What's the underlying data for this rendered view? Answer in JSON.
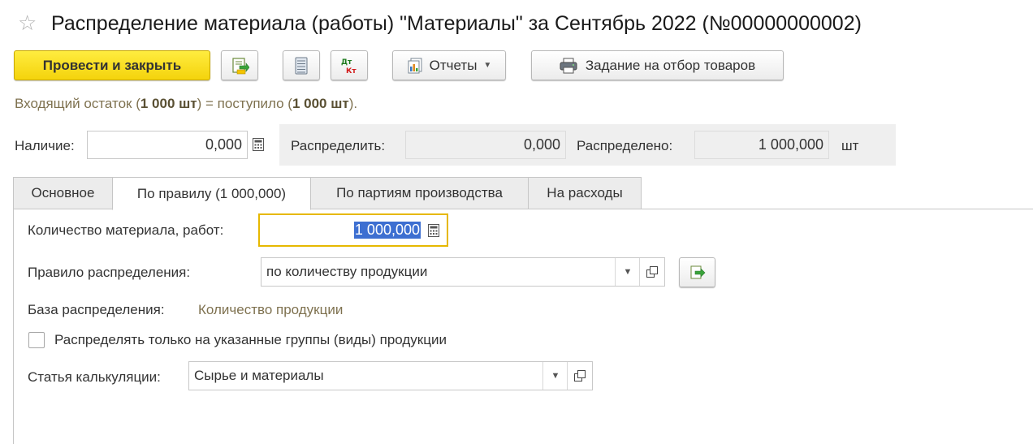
{
  "header": {
    "title": "Распределение материала (работы) \"Материалы\" за Сентябрь 2022 (№00000000002)",
    "favorite_icon": "star-icon"
  },
  "toolbar": {
    "post_close_label": "Провести и закрыть",
    "post_icon": "post-document-icon",
    "list_icon": "document-list-icon",
    "dtkt_icon": "dt-kt-postings-icon",
    "reports_label": "Отчеты",
    "reports_icon": "reports-icon",
    "picking_task_label": "Задание на отбор товаров",
    "print_icon": "printer-icon"
  },
  "summary": {
    "prefix": "Входящий остаток (",
    "incoming_qty": "1 000 шт",
    "middle": ") = поступило (",
    "received_qty": "1 000 шт",
    "suffix": ")."
  },
  "quantities": {
    "availability_label": "Наличие:",
    "availability_value": "0,000",
    "to_distribute_label": "Распределить:",
    "to_distribute_value": "0,000",
    "distributed_label": "Распределено:",
    "distributed_value": "1 000,000",
    "unit": "шт"
  },
  "tabs": [
    {
      "label": "Основное",
      "active": false
    },
    {
      "label": "По правилу (1 000,000)",
      "active": true
    },
    {
      "label": "По партиям производства",
      "active": false
    },
    {
      "label": "На расходы",
      "active": false
    }
  ],
  "rule_tab": {
    "material_qty_label": "Количество материала, работ:",
    "material_qty_value": "1 000,000",
    "rule_label": "Правило распределения:",
    "rule_value": "по количеству продукции",
    "base_label": "База распределения:",
    "base_value": "Количество продукции",
    "only_groups_label": "Распределять только на указанные группы (виды) продукции",
    "only_groups_checked": false,
    "cost_item_label": "Статья калькуляции:",
    "cost_item_value": "Сырье и материалы"
  },
  "colors": {
    "primary_button": "#f4d30c",
    "selection": "#3d6fd1",
    "focus_border": "#e6b800",
    "info_text": "#7f7250"
  }
}
